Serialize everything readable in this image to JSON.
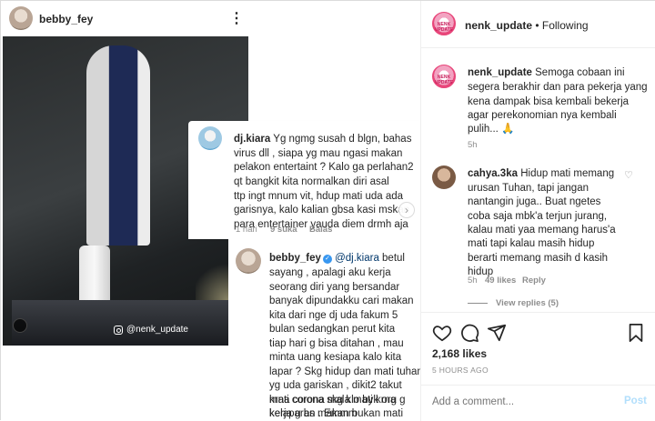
{
  "post": {
    "author": "bebby_fey",
    "more_icon": "more-dots-icon",
    "watermark": "@nenk_update",
    "comment1": {
      "author": "dj.kiara",
      "lines": [
        "Yg ngmg susah d blgn, bahas",
        "virus dll , siapa yg mau ngasi makan",
        "pelakon entertaint ? Kalo ga perlahan2",
        "qt bangkit kita normalkan diri asal",
        "ttp ingt mnum vit, hdup mati uda ada",
        "garisnya, kalo kalian gbsa kasi mskan",
        "para entertainer yauda diem drmh aja"
      ],
      "time": "1 hari",
      "likes": "9 suka",
      "reply": "Balas"
    },
    "reply1": {
      "author": "bebby_fey",
      "mention": "@dj.kiara",
      "first_line_rest": " betul",
      "lines": [
        "sayang , apalagi aku kerja",
        "seorang diri yang bersandar",
        "banyak dipundakku cari makan",
        "kita dari nge dj uda fakum 5",
        "bulan sedangkan perut kita",
        "tiap hari g bisa ditahan , mau",
        "minta uang kesiapa kalo kita",
        "lapar ? Skg hidup dan mati tuhan",
        "yg uda gariskan , dikit2 takut",
        "mati corona skg klo byk org g",
        "kerja g bs makan bukan mati",
        "krna corona mala mati krna",
        "kelaparan . Emmm"
      ]
    }
  },
  "sidebar": {
    "header": {
      "author": "nenk_update",
      "separator": " • ",
      "follow_status": "Following",
      "avatar_text": "NENK UPDATE"
    },
    "caption": {
      "author": "nenk_update",
      "lines_first": "Semoga cobaan ini",
      "lines": [
        "segera berakhir dan para pekerja yang",
        "kena dampak bisa kembali bekerja",
        "agar perekonomian nya kembali",
        "pulih... 🙏"
      ],
      "time": "5h"
    },
    "comment": {
      "author": "cahya.3ka",
      "first_line_rest": "Hidup mati memang",
      "lines": [
        "urusan Tuhan, tapi jangan",
        "nantangin juga.. Buat ngetes",
        "coba saja mbk'a terjun jurang,",
        "kalau mati yaa memang harus'a",
        "mati tapi kalau masih hidup",
        "berarti memang masih d kasih",
        "hidup"
      ],
      "time": "5h",
      "likes": "49 likes",
      "reply": "Reply",
      "view_replies": "View replies (5)"
    },
    "likes_count": "2,168 likes",
    "posted_time": "5 HOURS AGO",
    "comment_input_placeholder": "Add a comment...",
    "post_button": "Post",
    "icons": [
      "heart-icon",
      "comment-icon",
      "share-icon",
      "bookmark-icon"
    ]
  }
}
